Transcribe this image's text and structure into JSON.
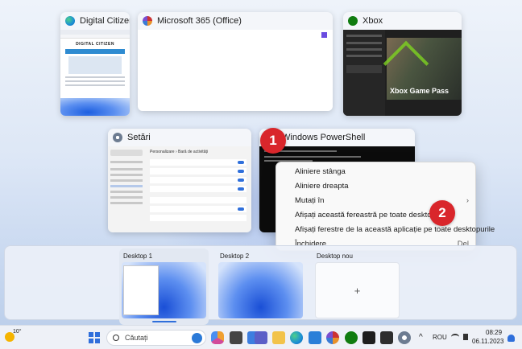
{
  "windows": {
    "digital_citizen": {
      "title": "Digital Citizen - L...",
      "logo_text": "DIGITAL CITIZEN"
    },
    "office": {
      "title": "Microsoft 365 (Office)"
    },
    "xbox": {
      "title": "Xbox",
      "game_title": "Xbox Game Pass"
    },
    "settings": {
      "title": "Setări",
      "breadcrumb": "Personalizare  ›  Bară de activități"
    },
    "powershell": {
      "title": "Windows PowerShell"
    }
  },
  "context_menu": {
    "items": [
      {
        "label": "Aliniere stânga",
        "shortcut": ""
      },
      {
        "label": "Aliniere dreapta",
        "shortcut": ""
      },
      {
        "label": "Mutați în",
        "shortcut": "›"
      },
      {
        "label": "Afișați această fereastră pe toate desktopurile",
        "shortcut": ""
      },
      {
        "label": "Afișați ferestre de la această aplicație pe toate desktopurile",
        "shortcut": ""
      },
      {
        "label": "Închidere",
        "shortcut": "Del"
      }
    ]
  },
  "callouts": {
    "one": "1",
    "two": "2"
  },
  "desktops": {
    "items": [
      {
        "label": "Desktop 1"
      },
      {
        "label": "Desktop 2"
      },
      {
        "label": "Desktop nou"
      }
    ],
    "new_symbol": "+"
  },
  "taskbar": {
    "weather_temp": "10°",
    "search_placeholder": "Căutați",
    "language": "ROU",
    "time": "08:29",
    "date": "06.11.2023",
    "chevron": "^"
  },
  "colors": {
    "accent_red": "#d9262b",
    "win_blue": "#2f6fdb",
    "xbox_green": "#107c10"
  }
}
